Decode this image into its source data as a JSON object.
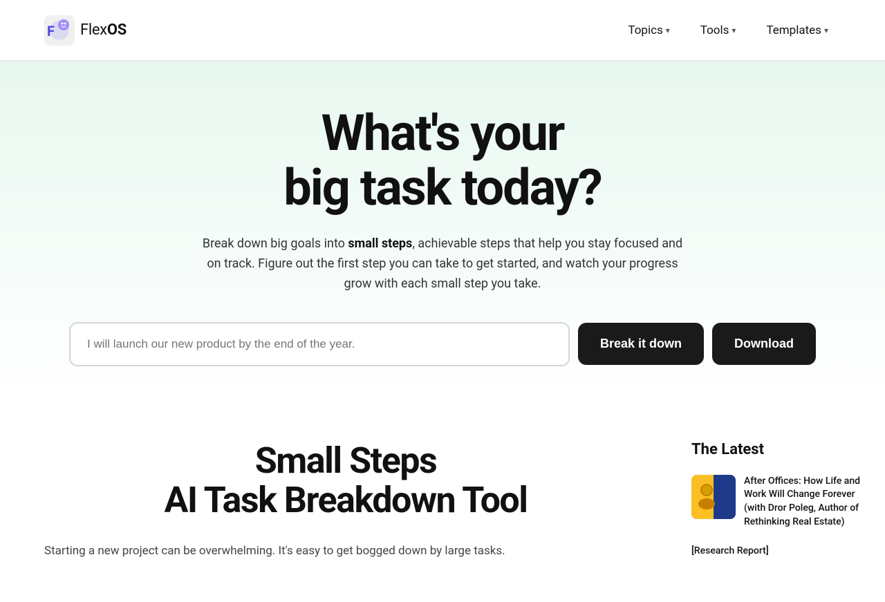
{
  "header": {
    "logo_text_plain": "Flex",
    "logo_text_bold": "OS",
    "nav": {
      "items": [
        {
          "label": "Topics",
          "has_chevron": true
        },
        {
          "label": "Tools",
          "has_chevron": true
        },
        {
          "label": "Templates",
          "has_chevron": true
        }
      ]
    }
  },
  "hero": {
    "title_line1": "What's your",
    "title_line2": "big task today?",
    "description_prefix": "Break down big goals into ",
    "description_bold": "small steps",
    "description_suffix": ", achievable steps that help you stay focused and on track. Figure out the first step you can take to get started, and watch your progress grow with each small step you take.",
    "input_placeholder": "I will launch our new product by the end of the year.",
    "btn_break_label": "Break it down",
    "btn_download_label": "Download"
  },
  "tool_section": {
    "title_line1": "Small Steps",
    "title_line2": "AI Task Breakdown Tool",
    "description": "Starting a new project can be overwhelming. It's easy to get bogged down by large tasks."
  },
  "sidebar": {
    "latest_title": "The Latest",
    "articles": [
      {
        "title": "After Offices: How Life and Work Will Change Forever (with Dror Poleg, Author of Rethinking Real Estate)",
        "has_thumb": true
      },
      {
        "title": "[Research Report]",
        "has_thumb": false
      }
    ]
  },
  "colors": {
    "accent_green": "#10b981",
    "dark": "#1a1a1a",
    "hero_bg_start": "#e8f8f0",
    "hero_bg_end": "#ffffff"
  }
}
